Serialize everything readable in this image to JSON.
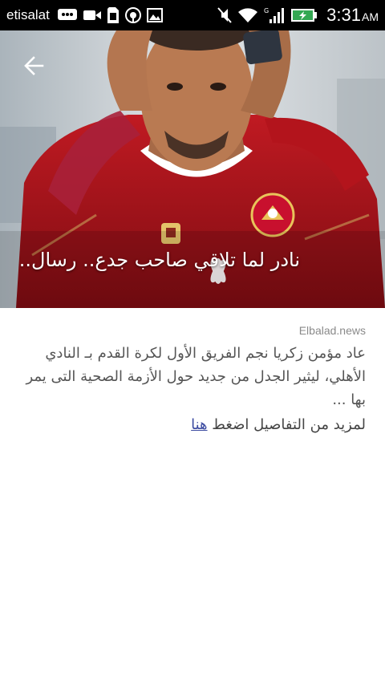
{
  "statusbar": {
    "carrier": "etisalat",
    "time": "3:31",
    "ampm": "AM",
    "network": "G"
  },
  "hero": {
    "title": "نادر لما تلاقي صاحب جدع.. رسال..",
    "back_icon": "arrow-left-icon"
  },
  "article": {
    "source": "Elbalad.news",
    "summary": "عاد مؤمن زكريا نجم الفريق الأول لكرة القدم بـ النادي الأهلي، ليثير الجدل من جديد حول الأزمة الصحية التى يمر بها ...",
    "more_text": "لمزيد من التفاصيل اضغط",
    "more_link": "هنا"
  },
  "colors": {
    "statusbar_bg": "#000000",
    "link": "#3b4aa0",
    "jersey": "#b3141c"
  }
}
